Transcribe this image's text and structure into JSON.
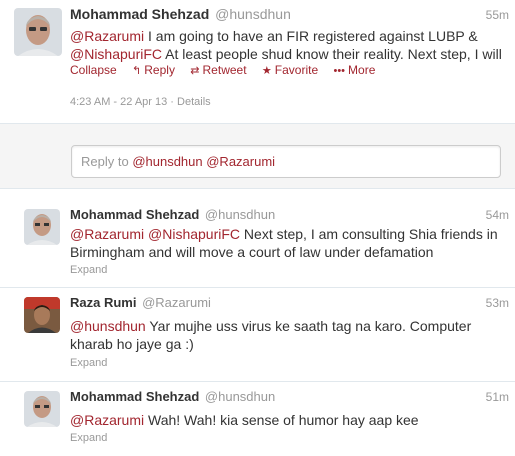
{
  "expanded_tweet": {
    "fullname": "Mohammad Shehzad",
    "username": "@hunsdhun",
    "time": "55m",
    "mention1": "@Razarumi",
    "text1": " I am going to have an FIR registered against LUBP &",
    "mention2": "@NishapuriFC",
    "text2": " At least people shud know their reality. Next step, I will",
    "actions": {
      "collapse": "Collapse",
      "reply": "Reply",
      "retweet": "Retweet",
      "favorite": "Favorite",
      "more": "More"
    },
    "timestamp": "4:23 AM - 22 Apr 13",
    "details": "Details"
  },
  "reply_box": {
    "prefix": "Reply to ",
    "mentions": "@hunsdhun @Razarumi"
  },
  "tweets": [
    {
      "fullname": "Mohammad Shehzad",
      "username": "@hunsdhun",
      "time": "54m",
      "mention1": "@Razarumi",
      "mention2": "@NishapuriFC",
      "text_a": " Next step, I am consulting Shia friends in",
      "text_b": "Birmingham and will move a court of law under defamation",
      "expand": "Expand"
    },
    {
      "fullname": "Raza Rumi",
      "username": "@Razarumi",
      "time": "53m",
      "mention1": "@hunsdhun",
      "text_a": " Yar mujhe uss virus ke saath tag na karo. Computer",
      "text_b": "kharab ho jaye ga :)",
      "expand": "Expand"
    },
    {
      "fullname": "Mohammad Shehzad",
      "username": "@hunsdhun",
      "time": "51m",
      "mention1": "@Razarumi",
      "text_a": " Wah! Wah! kia sense of humor hay aap kee",
      "expand": "Expand"
    }
  ],
  "icons": {
    "reply": "reply-arrow",
    "retweet": "retweet-arrows",
    "favorite": "star",
    "more": "dots"
  },
  "colors": {
    "link": "#a2262f",
    "muted": "#999999",
    "text": "#333333"
  }
}
